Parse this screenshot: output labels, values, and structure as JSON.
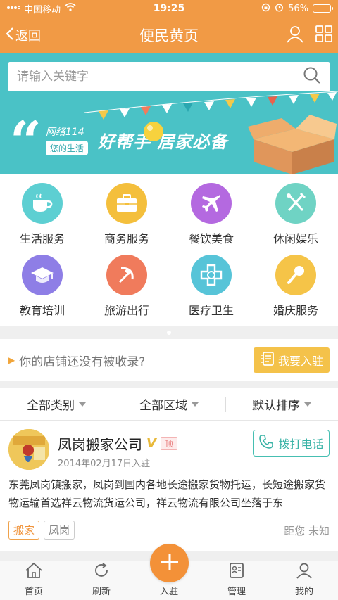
{
  "status_bar": {
    "carrier": "中国移动",
    "time": "19:25",
    "battery": "56%",
    "battery_level": 0.56
  },
  "nav": {
    "back_label": "返回",
    "title": "便民黄页"
  },
  "search": {
    "placeholder": "请输入关键字"
  },
  "banner": {
    "brand": "网络114",
    "pill": "您的生活",
    "slogan": "好帮手 居家必备"
  },
  "categories": [
    {
      "label": "生活服务",
      "icon": "coffee-cup-icon",
      "color": "#5dcfd2"
    },
    {
      "label": "商务服务",
      "icon": "briefcase-icon",
      "color": "#f4bf3c"
    },
    {
      "label": "餐饮美食",
      "icon": "airplane-icon",
      "color": "#b469e0"
    },
    {
      "label": "休闲娱乐",
      "icon": "fork-knife-icon",
      "color": "#6fd3c4"
    },
    {
      "label": "教育培训",
      "icon": "graduation-cap-icon",
      "color": "#8e7ee6"
    },
    {
      "label": "旅游出行",
      "icon": "hammer-sickle-icon",
      "color": "#f07b5c"
    },
    {
      "label": "医疗卫生",
      "icon": "medical-cross-icon",
      "color": "#57c4d8"
    },
    {
      "label": "婚庆服务",
      "icon": "microphone-icon",
      "color": "#f5c448"
    }
  ],
  "notice": {
    "text": "你的店铺还没有被收录?",
    "button": "我要入驻"
  },
  "filters": [
    {
      "label": "全部类别"
    },
    {
      "label": "全部区域"
    },
    {
      "label": "默认排序"
    }
  ],
  "listing": {
    "name": "凤岗搬家公司",
    "verified_mark": "V",
    "badge": "顶",
    "date": "2014年02月17日入驻",
    "call_label": "拨打电话",
    "description": "东莞凤岗镇搬家，凤岗到国内各地长途搬家货物托运，长短途搬家货物运输首选祥云物流货运公司，祥云物流有限公司坐落于东",
    "tags": [
      "搬家",
      "凤岗"
    ],
    "distance": "距您 未知"
  },
  "tabbar": {
    "home": "首页",
    "refresh": "刷新",
    "join": "入驻",
    "manage": "管理",
    "mine": "我的"
  },
  "colors": {
    "accent": "#f19a45",
    "banner": "#4ac2c6",
    "teal": "#39b3a6"
  }
}
